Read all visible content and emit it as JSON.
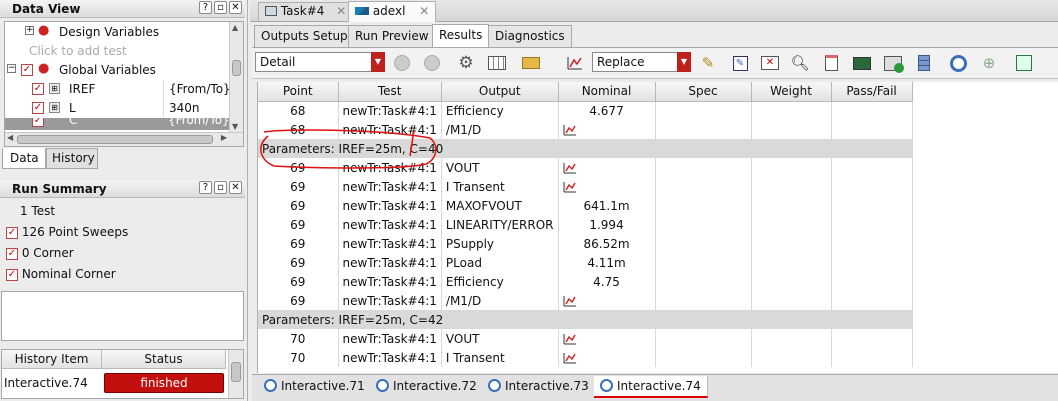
{
  "data_view": {
    "title": "Data View",
    "rows": [
      {
        "label": "Design Variables"
      },
      {
        "label": "Click to add test"
      },
      {
        "label": "Global Variables"
      },
      {
        "label": "IREF",
        "value": "{From/To}"
      },
      {
        "label": "L",
        "value": "340n"
      },
      {
        "label": "C",
        "value": "{From/To}"
      }
    ],
    "tabs": [
      "Data",
      "History"
    ]
  },
  "run_summary": {
    "title": "Run Summary",
    "items": [
      "1 Test",
      "126 Point Sweeps",
      "0 Corner",
      "Nominal Corner"
    ]
  },
  "history": {
    "columns": [
      "History Item",
      "Status"
    ],
    "item": "Interactive.74",
    "status": "finished"
  },
  "top_tabs": [
    "Task#4",
    "adexl"
  ],
  "sub_tabs": [
    "Outputs Setup",
    "Run Preview",
    "Results",
    "Diagnostics"
  ],
  "toolbar": {
    "view_mode": "Detail",
    "replace_mode": "Replace"
  },
  "results": {
    "columns": [
      "Point",
      "Test",
      "Output",
      "Nominal",
      "Spec",
      "Weight",
      "Pass/Fail"
    ],
    "rows": [
      {
        "type": "data",
        "point": "68",
        "test": "newTr:Task#4:1",
        "output": "Efficiency",
        "nominal": "4.677"
      },
      {
        "type": "data",
        "point": "68",
        "test": "newTr:Task#4:1",
        "output": "/M1/D",
        "nominal": "",
        "wave": true
      },
      {
        "type": "param",
        "label": "Parameters: IREF=25m, C=40"
      },
      {
        "type": "data",
        "point": "69",
        "test": "newTr:Task#4:1",
        "output": "VOUT",
        "nominal": "",
        "wave": true
      },
      {
        "type": "data",
        "point": "69",
        "test": "newTr:Task#4:1",
        "output": "I Transent",
        "nominal": "",
        "wave": true
      },
      {
        "type": "data",
        "point": "69",
        "test": "newTr:Task#4:1",
        "output": "MAXOFVOUT",
        "nominal": "641.1m"
      },
      {
        "type": "data",
        "point": "69",
        "test": "newTr:Task#4:1",
        "output": "LINEARITY/ERROR",
        "nominal": "1.994"
      },
      {
        "type": "data",
        "point": "69",
        "test": "newTr:Task#4:1",
        "output": "PSupply",
        "nominal": "86.52m"
      },
      {
        "type": "data",
        "point": "69",
        "test": "newTr:Task#4:1",
        "output": "PLoad",
        "nominal": "4.11m"
      },
      {
        "type": "data",
        "point": "69",
        "test": "newTr:Task#4:1",
        "output": "Efficiency",
        "nominal": "4.75"
      },
      {
        "type": "data",
        "point": "69",
        "test": "newTr:Task#4:1",
        "output": "/M1/D",
        "nominal": "",
        "wave": true
      },
      {
        "type": "param",
        "label": "Parameters: IREF=25m, C=42"
      },
      {
        "type": "data",
        "point": "70",
        "test": "newTr:Task#4:1",
        "output": "VOUT",
        "nominal": "",
        "wave": true
      },
      {
        "type": "data",
        "point": "70",
        "test": "newTr:Task#4:1",
        "output": "I Transent",
        "nominal": "",
        "wave": true
      }
    ]
  },
  "bottom_tabs": [
    "Interactive.71",
    "Interactive.72",
    "Interactive.73",
    "Interactive.74"
  ],
  "colors": {
    "accent": "#c0201c",
    "status_bg": "#c40f0f",
    "annotation": "#e01010"
  }
}
